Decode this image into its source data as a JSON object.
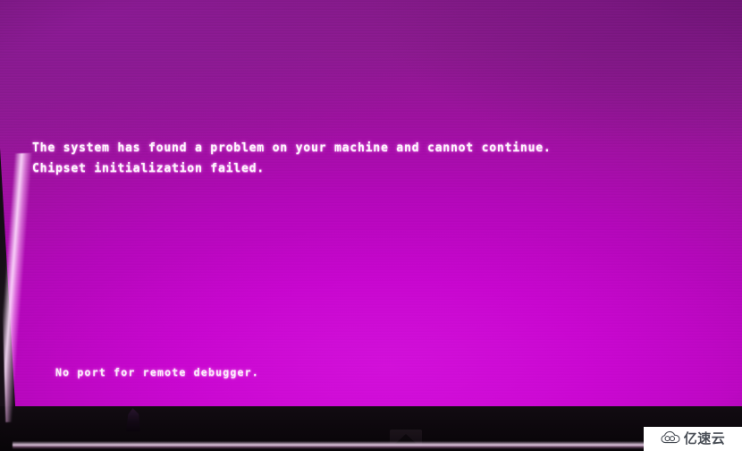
{
  "screen": {
    "kind": "firmware-error-screen",
    "messages": [
      "The system has found a problem on your machine and cannot continue.",
      "Chipset initialization failed.",
      "No port for remote debugger."
    ],
    "text_color": "#fdf7fd",
    "background_colors": {
      "hot_magenta": "#cf12d6",
      "magenta": "#c505cc",
      "mid_purple": "#b407ba",
      "dark_purple": "#8b1a8e",
      "edge_purple": "#7c1a82"
    }
  },
  "monitor": {
    "bezel_color": "#100b10",
    "bezel_logo_name": "monitor-brand-logo",
    "highlight_color": "#ffe1ff"
  },
  "photo": {
    "finger_name": "fingertip-silhouette"
  },
  "watermark": {
    "text": "亿速云",
    "icon": "cloud-logo-icon",
    "background": "#ffffff",
    "text_color": "#4a4f57"
  }
}
